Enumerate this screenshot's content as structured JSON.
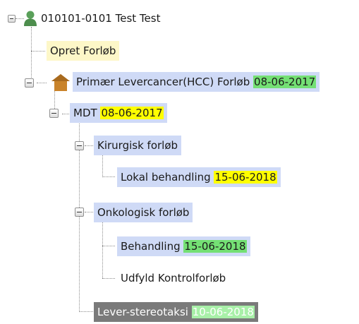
{
  "tree": {
    "root": {
      "label": "010101-0101 Test Test",
      "icon": "person-icon"
    },
    "opret": {
      "label": "Opret Forløb"
    },
    "primary": {
      "label": "Primær Levercancer(HCC) Forløb",
      "date": "08-06-2017",
      "icon": "house-icon"
    },
    "mdt": {
      "label": "MDT",
      "date": "08-06-2017"
    },
    "kirurgisk": {
      "label": "Kirurgisk forløb"
    },
    "lokal": {
      "label": "Lokal behandling",
      "date": "15-06-2018"
    },
    "onkologisk": {
      "label": "Onkologisk forløb"
    },
    "behandling": {
      "label": "Behandling",
      "date": "15-06-2018"
    },
    "udfyld": {
      "label": "Udfyld Kontrolforløb"
    },
    "lever": {
      "label": "Lever-stereotaksi",
      "date": "10-06-2018"
    }
  },
  "colors": {
    "selection_blue": "#cfdaf6",
    "highlight_yellow": "#fdf7c8",
    "date_green": "#74e074",
    "date_yellow": "#ffff00",
    "inactive_gray": "#7a7a7a",
    "person_icon_green": "#5aa05a",
    "house_icon_orange": "#c9832a"
  }
}
